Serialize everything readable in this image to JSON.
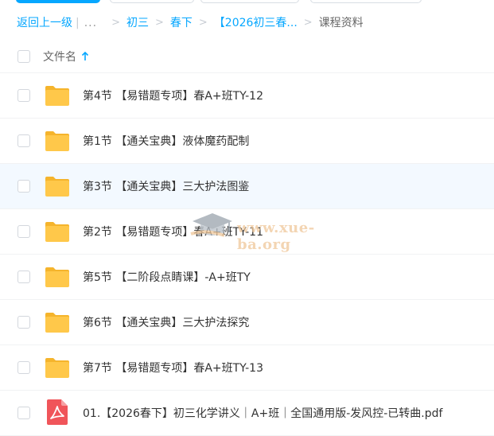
{
  "breadcrumb": {
    "back": "返回上一级",
    "more": "...",
    "items": [
      "初三",
      "春下",
      "【2026初三春..."
    ],
    "current": "课程资料"
  },
  "list_header": {
    "column_label": "文件名"
  },
  "files": [
    {
      "type": "folder",
      "name": "第4节 【易错题专项】春A+班TY-12"
    },
    {
      "type": "folder",
      "name": "第1节 【通关宝典】液体魔药配制"
    },
    {
      "type": "folder",
      "name": "第3节 【通关宝典】三大护法图鉴"
    },
    {
      "type": "folder",
      "name": "第2节 【易错题专项】春A+班TY-11"
    },
    {
      "type": "folder",
      "name": "第5节 【二阶段点睛课】-A+班TY"
    },
    {
      "type": "folder",
      "name": "第6节 【通关宝典】三大护法探究"
    },
    {
      "type": "folder",
      "name": "第7节 【易错题专项】春A+班TY-13"
    },
    {
      "type": "pdf",
      "name": "01.【2026春下】初三化学讲义｜A+班｜全国通用版-发风控-已转曲.pdf"
    }
  ],
  "watermark": {
    "text": "www.xue-ba.org"
  },
  "colors": {
    "accent": "#06a7ff",
    "folder": "#ffc84a",
    "folder_tab": "#f5b42c",
    "pdf": "#f0555a",
    "row_hover": "#f3f9ff"
  }
}
